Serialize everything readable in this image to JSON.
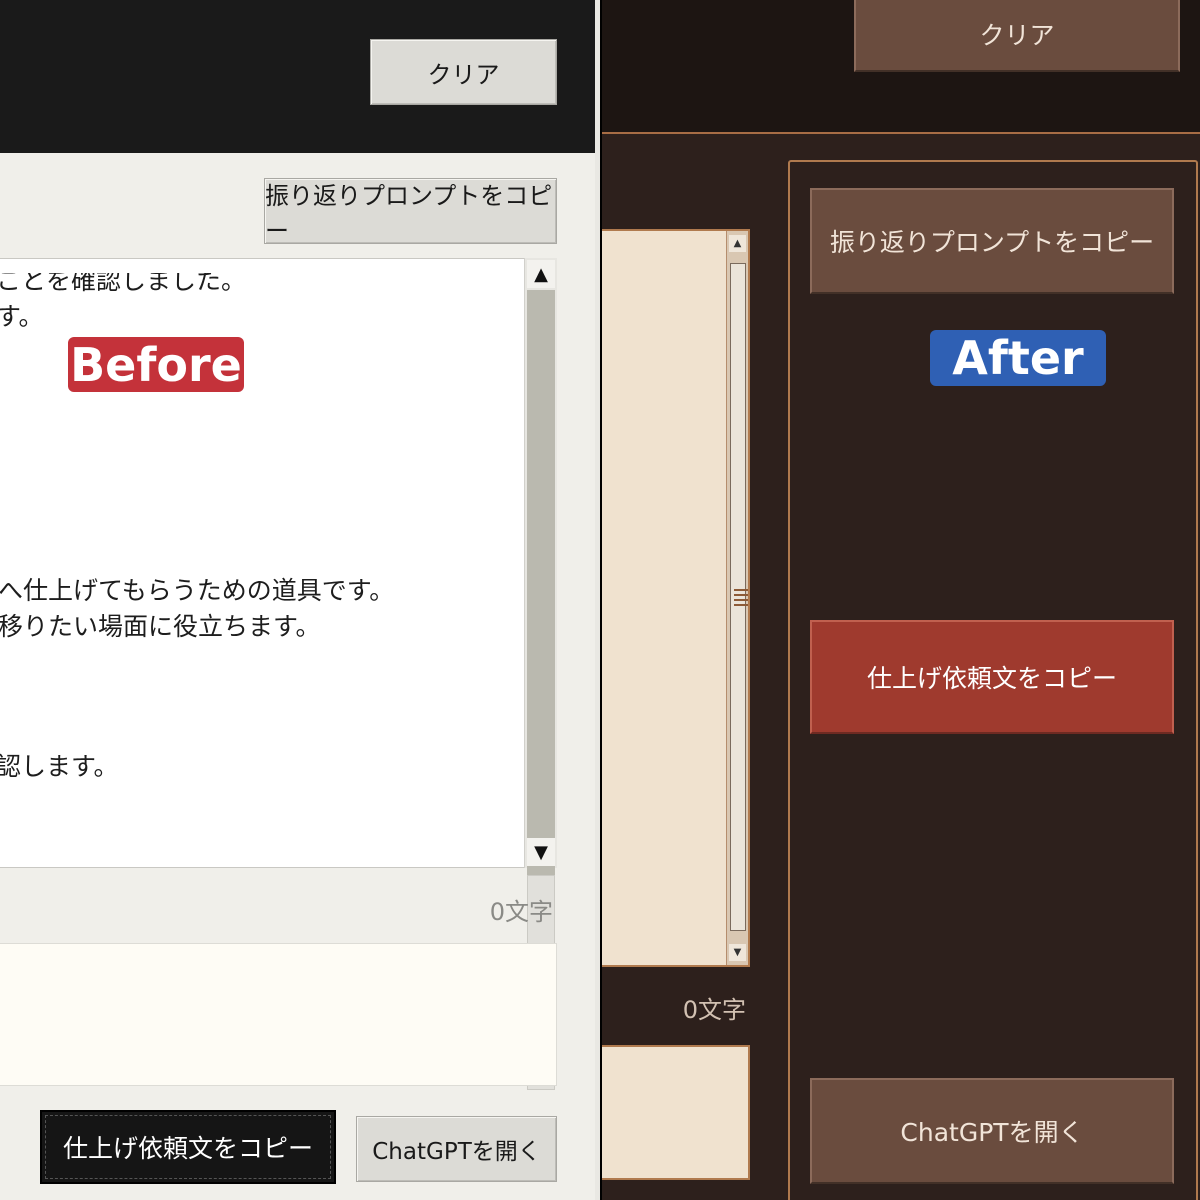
{
  "before": {
    "badge": "Before",
    "clear_label": "クリア",
    "copy_reflection_label": "振り返りプロンプトをコピー",
    "text_lines": [
      "ことを確認しました。",
      "す。",
      "。",
      "へ仕上げてもらうための道具です。",
      "移りたい場面に役立ちます。",
      "認します。"
    ],
    "scroll_up": "▲",
    "scroll_down": "▼",
    "char_count": "0文字",
    "finish_copy_label": "仕上げ依頼文をコピー",
    "open_chatgpt_label": "ChatGPTを開く"
  },
  "after": {
    "badge": "After",
    "clear_label": "クリア",
    "copy_reflection_label": "振り返りプロンプトをコピー",
    "scroll_up": "▲",
    "scroll_down": "▼",
    "char_count": "0文字",
    "finish_copy_label": "仕上げ依頼文をコピー",
    "open_chatgpt_label": "ChatGPTを開く"
  },
  "colors": {
    "before_background": "#f0efea",
    "after_background": "#2d201c",
    "after_accent_button": "#9f3a2e",
    "after_border": "#b07a4e",
    "before_badge": "#c4323a",
    "after_badge": "#2f60b4"
  }
}
